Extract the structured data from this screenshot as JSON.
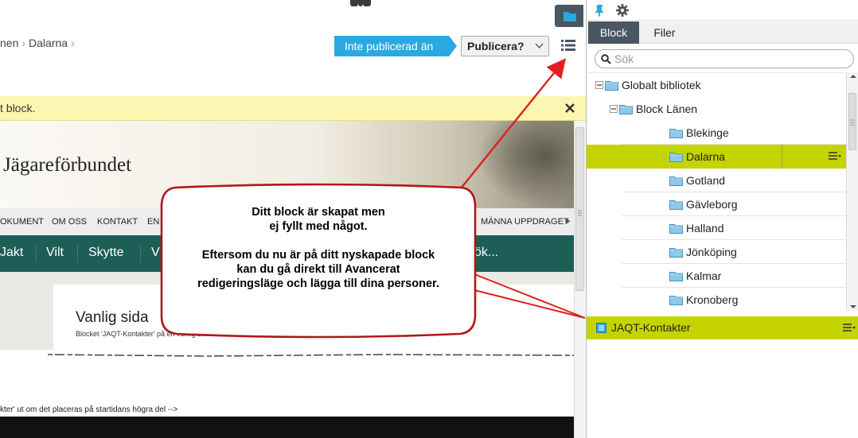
{
  "editor": {
    "breadcrumb": [
      "nen",
      "Dalarna"
    ],
    "status": "Inte publicerad än",
    "publish_label": "Publicera?",
    "notice": "t block."
  },
  "site": {
    "title": "Jägareförbundet",
    "top_nav": [
      "OKUMENT",
      "OM OSS",
      "KONTAKT",
      "EN",
      "MÄNNA UPPDRAGET"
    ],
    "main_nav": [
      "Jakt",
      "Vilt",
      "Skytte",
      "V",
      "ök..."
    ],
    "page_heading": "Vanlig sida",
    "page_subtext": "Blocket 'JAQT-Kontakter' på en vanlig sida",
    "comment_line": "kter' ut om det placeras på startidans högra del -->"
  },
  "panel": {
    "tabs": [
      "Block",
      "Filer"
    ],
    "active_tab": "Block",
    "search_placeholder": "Sök",
    "tree": [
      {
        "label": "Globalt bibliotek",
        "level": 0,
        "toggle": "minus"
      },
      {
        "label": "Block Länen",
        "level": 1,
        "toggle": "minus"
      },
      {
        "label": "Blekinge",
        "level": 2
      },
      {
        "label": "Dalarna",
        "level": 2,
        "selected": true
      },
      {
        "label": "Gotland",
        "level": 2
      },
      {
        "label": "Gävleborg",
        "level": 2
      },
      {
        "label": "Halland",
        "level": 2
      },
      {
        "label": "Jönköping",
        "level": 2
      },
      {
        "label": "Kalmar",
        "level": 2
      },
      {
        "label": "Kronoberg",
        "level": 2
      }
    ],
    "block_item": "JAQT-Kontakter"
  },
  "callout": {
    "lines": [
      "Ditt block är skapat men",
      "ej fyllt med något.",
      "",
      "Eftersom du nu är på ditt nyskapade block",
      "kan du gå direkt till Avancerat",
      "redigeringsläge och lägga till dina personer."
    ]
  },
  "colors": {
    "accent_status": "#2aa9e0",
    "selection": "#c5d400",
    "notice_bg": "#fdf6b0",
    "site_nav": "#1d5e57",
    "arrow": "#e02020"
  }
}
